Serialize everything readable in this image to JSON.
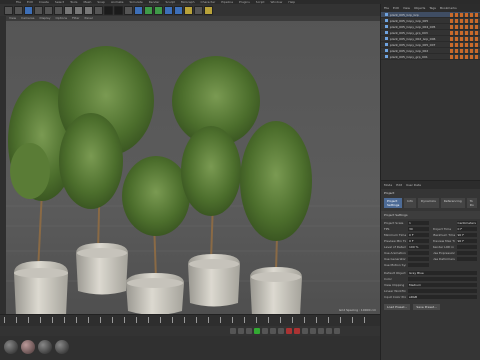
{
  "menubar": [
    "File",
    "Edit",
    "Create",
    "Select",
    "Tools",
    "Mesh",
    "Snap",
    "Animate",
    "Simulate",
    "Render",
    "Sculpt",
    "MoGraph",
    "Character",
    "Pipeline",
    "Plugins",
    "Script",
    "Window",
    "Help"
  ],
  "viewport": {
    "menu": [
      "View",
      "Cameras",
      "Display",
      "Options",
      "Filter",
      "Panel"
    ],
    "status": "Grid Spacing : 10000 cm"
  },
  "objects": {
    "menu": [
      "File",
      "Edit",
      "View",
      "Objects",
      "Tags",
      "Bookmarks"
    ],
    "items": [
      {
        "name": "plant_005_Grp_Grp"
      },
      {
        "name": "plant_005_Copy_Grp_005"
      },
      {
        "name": "plant_005_Copy_Grp_004_005"
      },
      {
        "name": "plant_005_Copy_grp_003"
      },
      {
        "name": "plant_005_Copy_002_Grp_006"
      },
      {
        "name": "plant_005_Copy_Grp_005_007"
      },
      {
        "name": "plant_005_Copy_Grp_002"
      },
      {
        "name": "plant_005_Copy_grp_001"
      }
    ]
  },
  "attributes": {
    "menu": [
      "Mode",
      "Edit",
      "User Data"
    ],
    "title": "Project",
    "tabs": [
      "Project Settings",
      "Info",
      "Dynamics",
      "Referencing",
      "To Do"
    ],
    "section": "Project Settings",
    "fields": [
      {
        "label": "Project Scale",
        "value": "1"
      },
      {
        "label": "",
        "value": "Centimeters"
      },
      {
        "label": "FPS",
        "value": "30"
      },
      {
        "label": "Project Time",
        "value": "0 F"
      },
      {
        "label": "Minimum Time",
        "value": "0 F"
      },
      {
        "label": "Maximum Time",
        "value": "90 F"
      },
      {
        "label": "Preview Min Time",
        "value": "0 F"
      },
      {
        "label": "Preview Max Time",
        "value": "90 F"
      },
      {
        "label": "Level of Detail",
        "value": "100 %"
      },
      {
        "label": "Render LOD in Editor",
        "value": ""
      },
      {
        "label": "Use Animation",
        "value": ""
      },
      {
        "label": "Use Expression",
        "value": ""
      },
      {
        "label": "Use Generators",
        "value": ""
      },
      {
        "label": "Use Deformers",
        "value": ""
      },
      {
        "label": "Use Motion System",
        "value": ""
      }
    ],
    "list": [
      {
        "label": "Default Object Color",
        "value": "Gray Blue"
      },
      {
        "label": "Color",
        "value": ""
      },
      {
        "label": "View Clipping",
        "value": "Medium"
      },
      {
        "label": "Linear Workflow",
        "value": ""
      },
      {
        "label": "Input Color Profile",
        "value": "sRGB"
      }
    ],
    "buttons": [
      "Load Preset...",
      "Save Preset..."
    ]
  },
  "materials": [
    "mat-1",
    "mat-2",
    "mat-3",
    "mat-4"
  ]
}
